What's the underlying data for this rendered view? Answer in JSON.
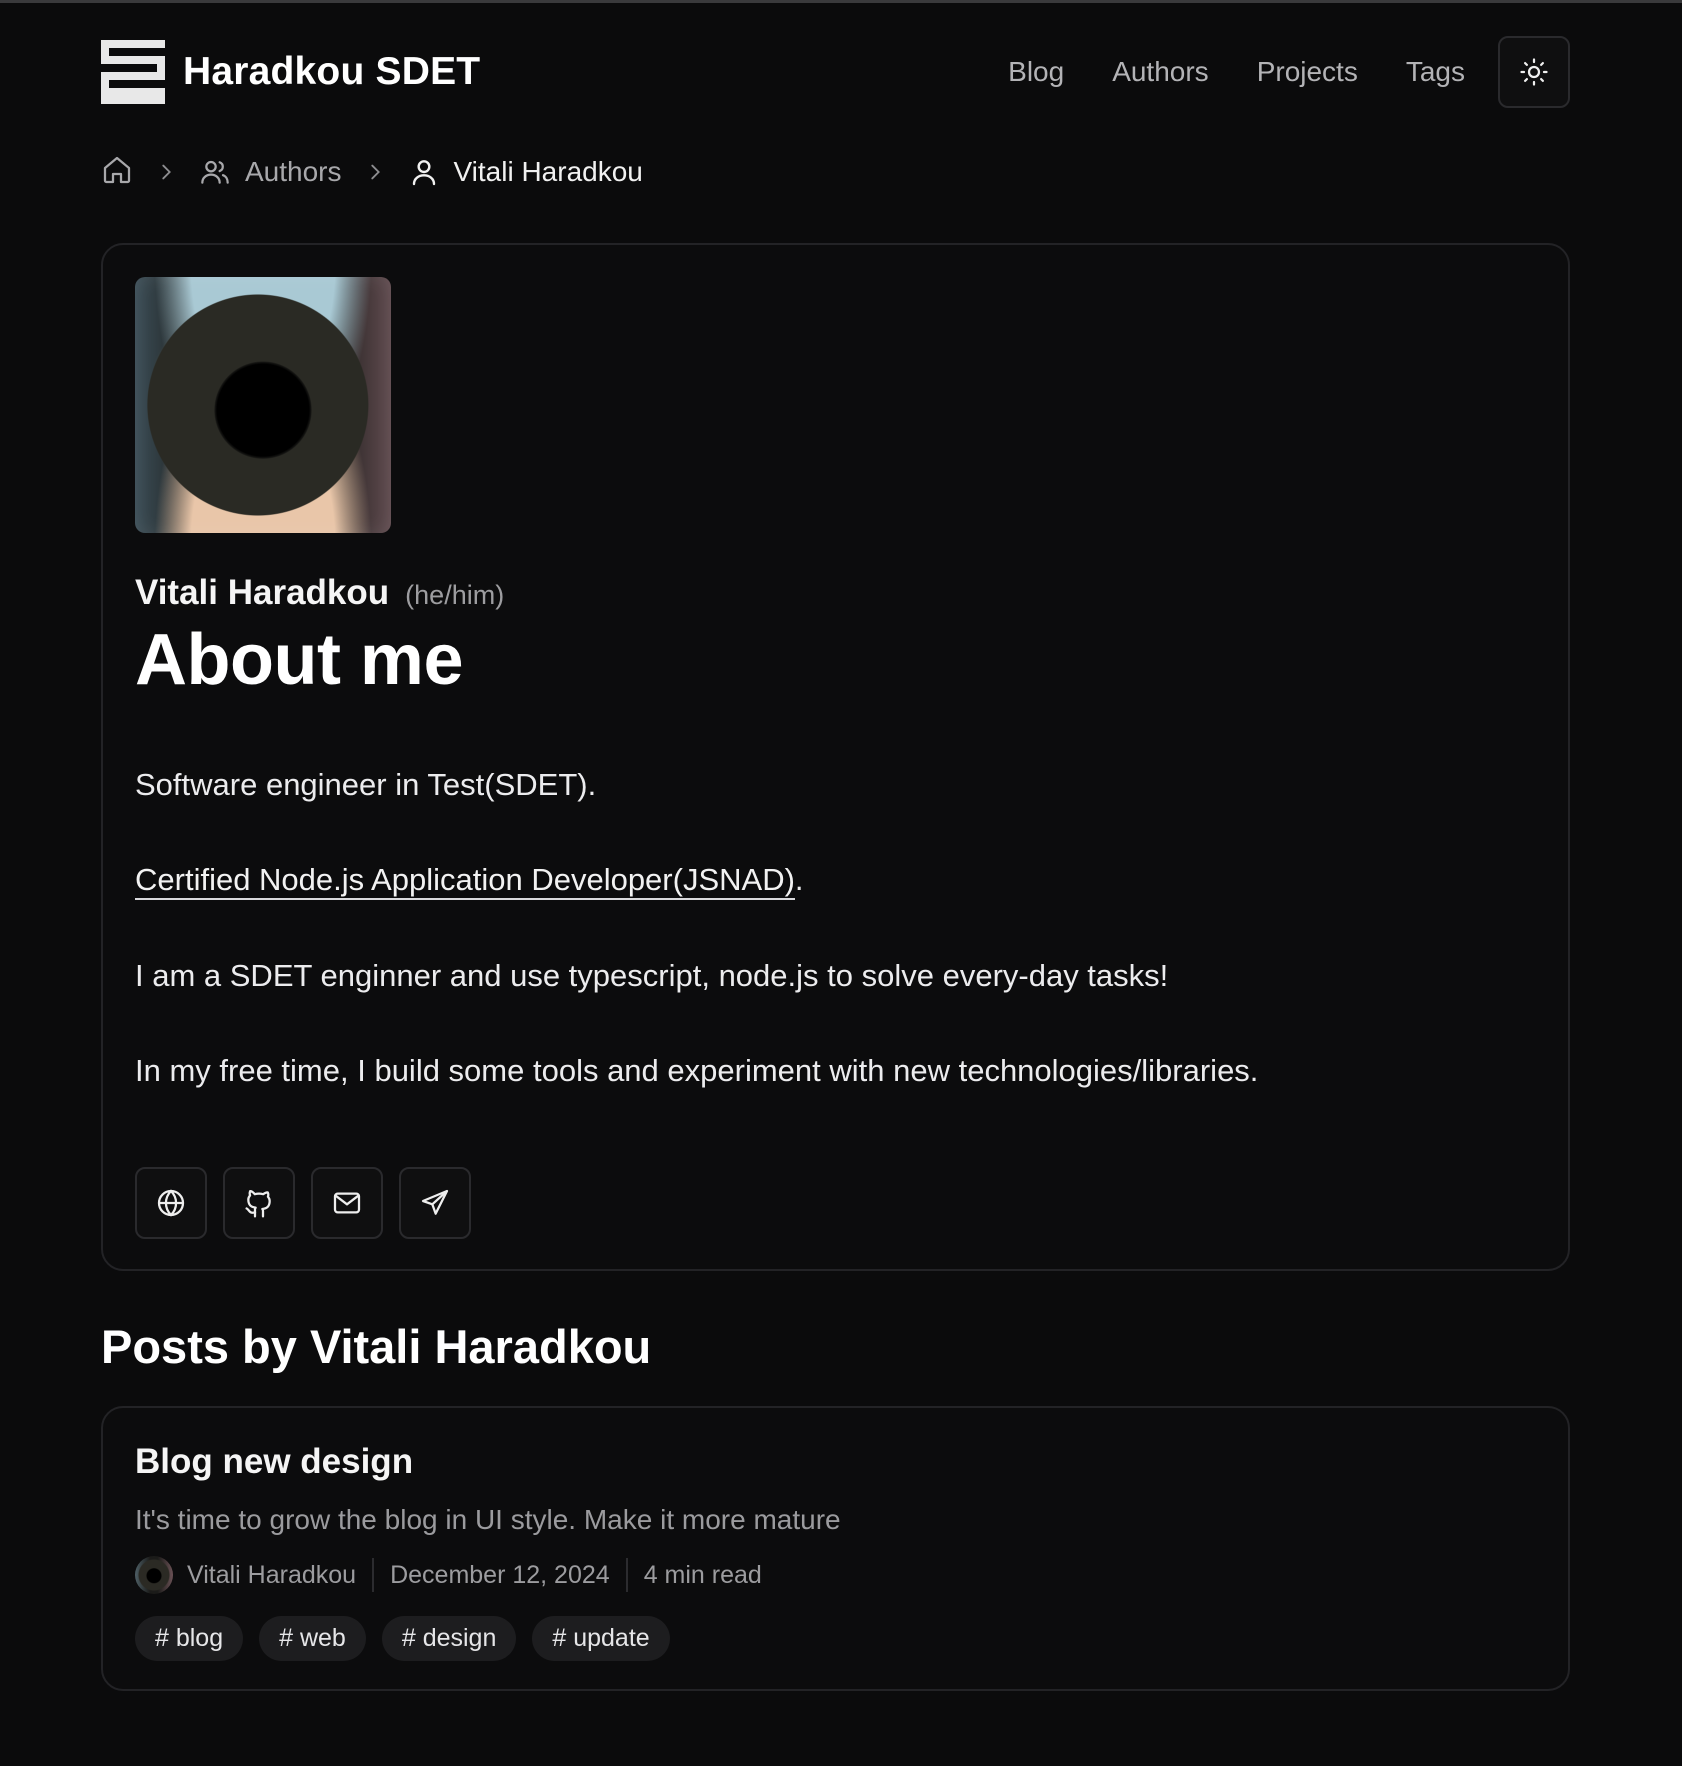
{
  "header": {
    "brand_title": "Haradkou SDET",
    "logo_icon": "stacked-bars-logo",
    "nav": [
      {
        "label": "Blog"
      },
      {
        "label": "Authors"
      },
      {
        "label": "Projects"
      },
      {
        "label": "Tags"
      }
    ],
    "theme_toggle_icon": "sun-icon"
  },
  "breadcrumb": {
    "home_icon": "home-icon",
    "items": [
      {
        "label": "Authors",
        "icon": "users-icon"
      },
      {
        "label": "Vitali Haradkou",
        "icon": "user-icon"
      }
    ]
  },
  "profile": {
    "name": "Vitali Haradkou",
    "pronouns": "(he/him)",
    "title": "About me",
    "bio": {
      "line1": "Software engineer in Test(SDET).",
      "certification_link": "Certified Node.js Application Developer(JSNAD)",
      "certification_suffix": ".",
      "line3": "I am a SDET enginner and use typescript, node.js to solve every-day tasks!",
      "line4": "In my free time, I build some tools and experiment with new technologies/libraries."
    },
    "socials": [
      {
        "icon": "globe-icon"
      },
      {
        "icon": "github-icon"
      },
      {
        "icon": "mail-icon"
      },
      {
        "icon": "send-icon"
      }
    ]
  },
  "posts": {
    "heading": "Posts by Vitali Haradkou",
    "items": [
      {
        "title": "Blog new design",
        "description": "It's time to grow the blog in UI style. Make it more mature",
        "author": "Vitali Haradkou",
        "date": "December 12, 2024",
        "read_time": "4 min read",
        "tags": [
          "# blog",
          "# web",
          "# design",
          "# update"
        ]
      }
    ]
  },
  "colors": {
    "background": "#0b0b0c",
    "card_border": "#232326",
    "text_primary": "#f2f2f2",
    "text_muted": "#9b9b9e",
    "tag_background": "#1d1d1f"
  }
}
